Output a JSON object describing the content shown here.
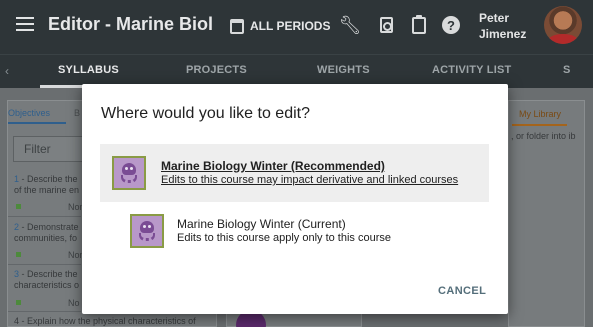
{
  "header": {
    "title": "Editor - Marine Biolo...",
    "period": "ALL PERIODS",
    "user": {
      "first_name": "Peter",
      "last_name": "Jimenez"
    }
  },
  "tabs": [
    {
      "label": "SYLLABUS",
      "active": true
    },
    {
      "label": "PROJECTS",
      "active": false
    },
    {
      "label": "WEIGHTS",
      "active": false
    },
    {
      "label": "ACTIVITY LIST",
      "active": false
    },
    {
      "label": "S",
      "active": false
    }
  ],
  "left_panel": {
    "tabs": [
      "Objectives",
      "B"
    ],
    "filter_placeholder": "Filter",
    "objectives": [
      {
        "number": "1",
        "text": " - Describe the",
        "text2": "of the marine en",
        "status": "Non"
      },
      {
        "number": "2",
        "text": " - Demonstrate",
        "text2": "communities, fo",
        "status": "Non"
      },
      {
        "number": "3",
        "text": " - Describe the",
        "text2": "characteristics o",
        "status": "No"
      }
    ],
    "objective_4": "4 - Explain how the physical characteristics of"
  },
  "right_panel": {
    "tab": "My Library",
    "text": ", or folder into ib"
  },
  "dialog": {
    "title": "Where would you like to edit?",
    "options": [
      {
        "title": "Marine Biology Winter (Recommended)",
        "subtitle": "Edits to this course may impact derivative and linked courses"
      },
      {
        "title": "Marine Biology Winter (Current)",
        "subtitle": "Edits to this course apply only to this course"
      }
    ],
    "cancel_label": "CANCEL"
  },
  "colors": {
    "topbar": "#2e3538",
    "overlay": "#6a6e70",
    "dialog_bg": "#ffffff",
    "cancel": "#546e7a",
    "course_icon_border": "#8a9b45",
    "course_icon_bg": "#b898c9"
  },
  "icons": [
    "menu-icon",
    "calendar-icon",
    "wrench-icon",
    "document-search-icon",
    "clipboard-icon",
    "help-icon",
    "chevron-left-icon",
    "octopus-icon"
  ]
}
